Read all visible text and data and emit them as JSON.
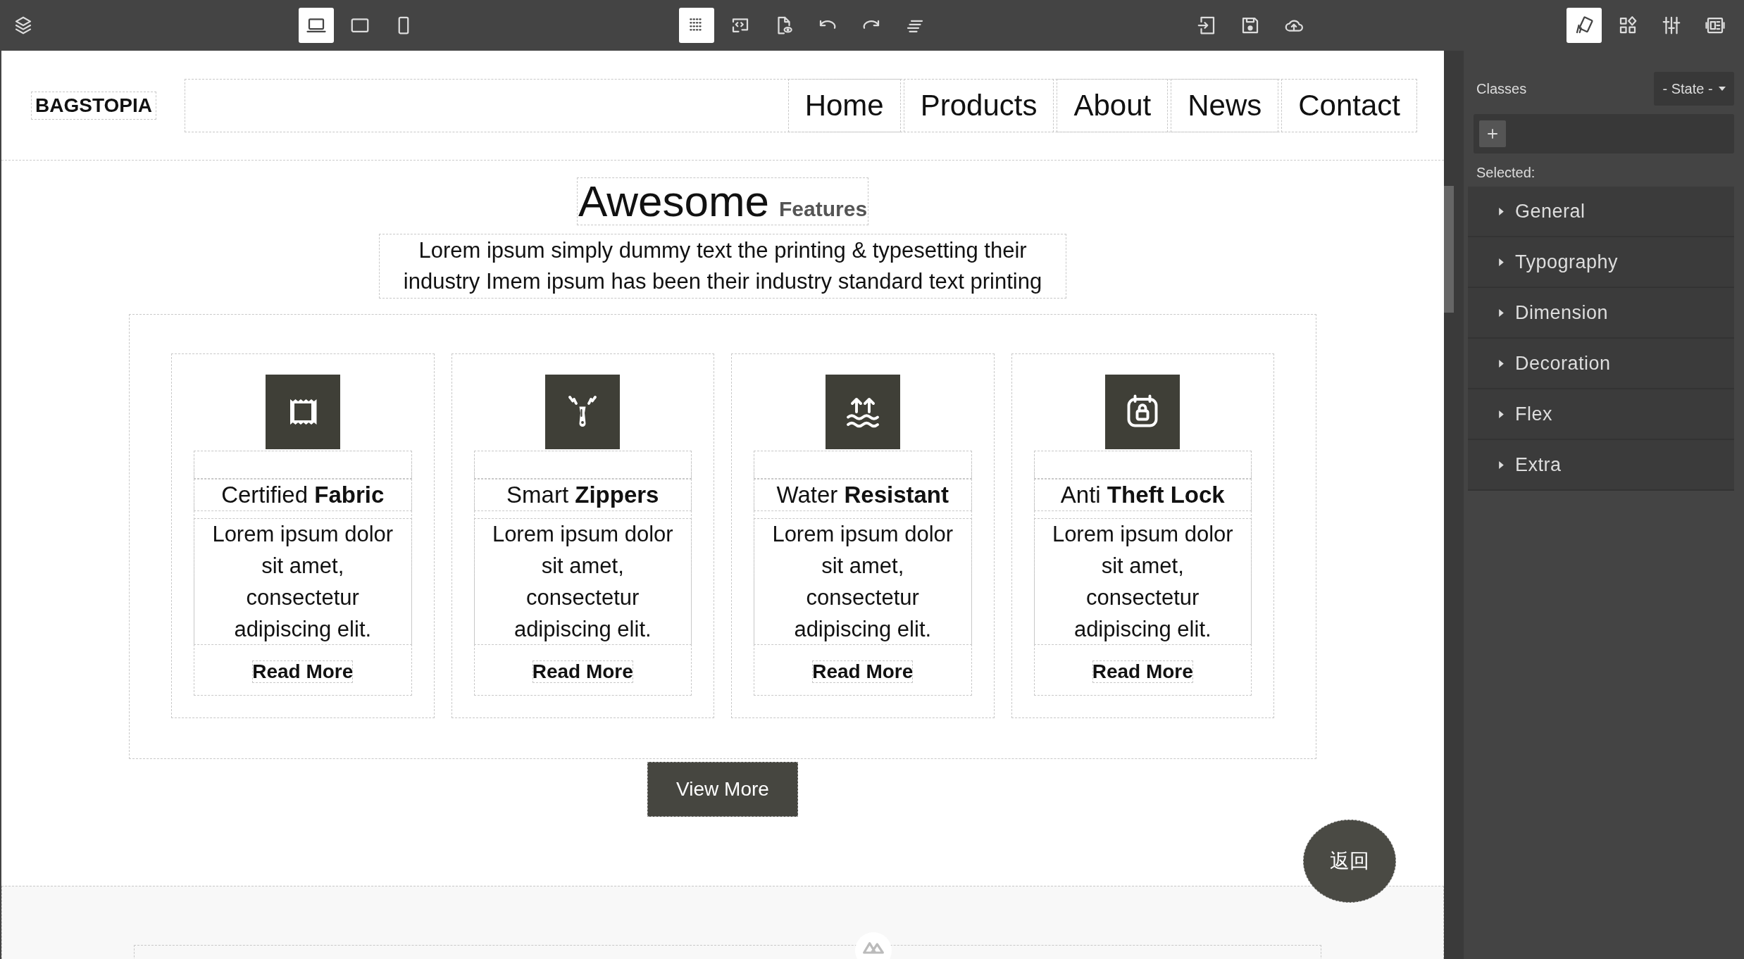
{
  "toolbar": {
    "left": [
      {
        "kind": "layers",
        "selected": false
      }
    ],
    "devices": [
      {
        "kind": "desktop",
        "selected": true
      },
      {
        "kind": "tablet",
        "selected": false
      },
      {
        "kind": "mobile",
        "selected": false
      }
    ],
    "options": [
      {
        "kind": "grid",
        "selected": true
      },
      {
        "kind": "code",
        "selected": false
      },
      {
        "kind": "preview",
        "selected": false
      },
      {
        "kind": "undo",
        "selected": false
      },
      {
        "kind": "redo",
        "selected": false
      },
      {
        "kind": "lines",
        "selected": false
      }
    ],
    "file": [
      {
        "kind": "import",
        "selected": false
      },
      {
        "kind": "save",
        "selected": false
      },
      {
        "kind": "cloud",
        "selected": false
      }
    ],
    "panels": [
      {
        "kind": "brush",
        "selected": true
      },
      {
        "kind": "blocks",
        "selected": false
      },
      {
        "kind": "sliders",
        "selected": false
      },
      {
        "kind": "layout",
        "selected": false
      }
    ]
  },
  "site": {
    "logo": "BAGSTOPIA",
    "nav": [
      "Home",
      "Products",
      "About",
      "News",
      "Contact"
    ],
    "heading": "Awesome",
    "heading_small": "Features",
    "intro": "Lorem ipsum simply dummy text the printing & typesetting their industry Imem ipsum has been their industry standard text printing",
    "cards": [
      {
        "kind": "fabric",
        "title": "Certified **Fabric**",
        "text": "Lorem ipsum dolor sit amet, consectetur adipiscing elit.",
        "link": "Read More"
      },
      {
        "kind": "zipper",
        "title": "Smart **Zippers**",
        "text": "Lorem ipsum dolor sit amet, consectetur adipiscing elit.",
        "link": "Read More"
      },
      {
        "kind": "water",
        "title": "Water **Resistant**",
        "text": "Lorem ipsum dolor sit amet, consectetur adipiscing elit.",
        "link": "Read More"
      },
      {
        "kind": "lock",
        "title": "Anti **Theft Lock**",
        "text": "Lorem ipsum dolor sit amet, consectetur adipiscing elit.",
        "link": "Read More"
      }
    ],
    "button": "View More",
    "back": "返回"
  },
  "style_manager": {
    "classes_label": "Classes",
    "state": "- State -",
    "selected_label": "Selected:",
    "sectors": [
      {
        "label": "General",
        "expanded": false
      },
      {
        "label": "Typography",
        "expanded": false
      },
      {
        "label": "Dimension",
        "expanded": false
      },
      {
        "label": "Decoration",
        "expanded": false
      },
      {
        "label": "Flex",
        "expanded": false
      },
      {
        "label": "Extra",
        "expanded": false
      }
    ]
  }
}
